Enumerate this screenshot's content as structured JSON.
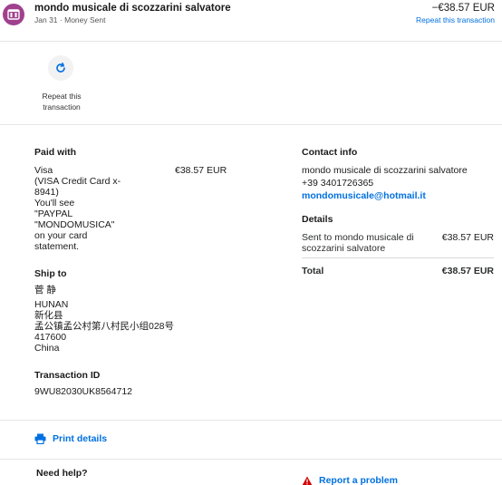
{
  "header": {
    "merchant_name": "mondo musicale di scozzarini salvatore",
    "date": "Jan 31",
    "separator": "·",
    "transaction_type": "Money Sent",
    "amount": "−€38.57 EUR",
    "repeat_link": "Repeat this transaction",
    "avatar_color": "#a0418e"
  },
  "repeat_action": {
    "label": "Repeat this transaction",
    "icon": "repeat-icon",
    "icon_color": "#0070e0"
  },
  "paid_with": {
    "title": "Paid with",
    "lines": [
      "Visa",
      "(VISA Credit Card x-",
      "8941)",
      "You'll see",
      "\"PAYPAL",
      "\"MONDOMUSICA\"",
      "on your card",
      "statement."
    ],
    "amount": "€38.57 EUR"
  },
  "ship_to": {
    "title": "Ship to",
    "lines": [
      "菅 静",
      "HUNAN",
      "新化县",
      "孟公镇孟公村第八村民小组028号",
      "417600",
      "China"
    ]
  },
  "transaction_id": {
    "title": "Transaction ID",
    "value": "9WU82030UK8564712"
  },
  "contact_info": {
    "title": "Contact info",
    "name": "mondo musicale di scozzarini salvatore",
    "phone": "+39 3401726365",
    "email": "mondomusicale@hotmail.it"
  },
  "details": {
    "title": "Details",
    "row_label": "Sent to mondo musicale di scozzarini salvatore",
    "row_amount": "€38.57 EUR",
    "total_label": "Total",
    "total_amount": "€38.57 EUR"
  },
  "actions": {
    "print_label": "Print details",
    "print_icon": "printer-icon",
    "report_label": "Report a problem",
    "report_icon": "warning-icon",
    "accent_color": "#0070e0",
    "warning_color": "#d20000"
  },
  "help": {
    "title": "Need help?"
  }
}
